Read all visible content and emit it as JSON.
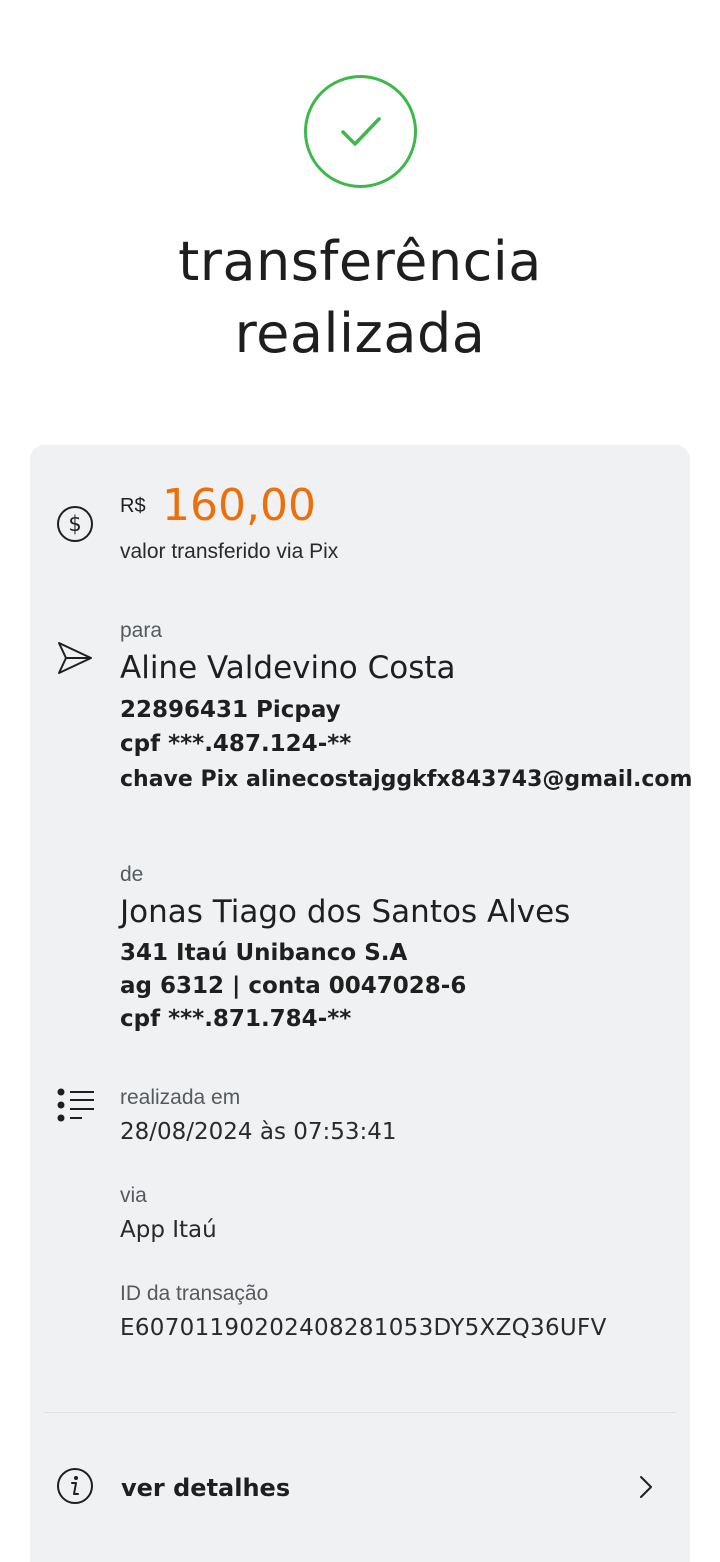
{
  "header": {
    "status_icon": "check-icon",
    "title_line1": "transferência",
    "title_line2": "realizada"
  },
  "amount": {
    "icon": "dollar-circle-icon",
    "currency": "R$",
    "value": "160,00",
    "caption": "valor transferido via Pix",
    "color": "#ec6f0b"
  },
  "recipient": {
    "icon": "send-icon",
    "label": "para",
    "name": "Aline Valdevino Costa",
    "bank": "22896431 Picpay",
    "cpf": "cpf ***.487.124-**",
    "pix_key": "chave Pix alinecostajggkfx843743@gmail.com"
  },
  "sender": {
    "label": "de",
    "name": "Jonas Tiago dos Santos Alves",
    "bank": "341 Itaú Unibanco S.A",
    "account": "ag 6312 | conta 0047028-6",
    "cpf": "cpf ***.871.784-**"
  },
  "info": {
    "icon": "list-icon",
    "date_label": "realizada em",
    "date_value": "28/08/2024 às 07:53:41",
    "via_label": "via",
    "via_value": "App Itaú",
    "id_label": "ID da transação",
    "id_value": "E60701190202408281053DY5XZQ36UFV"
  },
  "details": {
    "icon": "info-icon",
    "label": "ver detalhes",
    "chevron": "chevron-right-icon"
  },
  "colors": {
    "success": "#3cb94a",
    "card_bg": "#eff1f3",
    "accent": "#ec6f0b"
  }
}
